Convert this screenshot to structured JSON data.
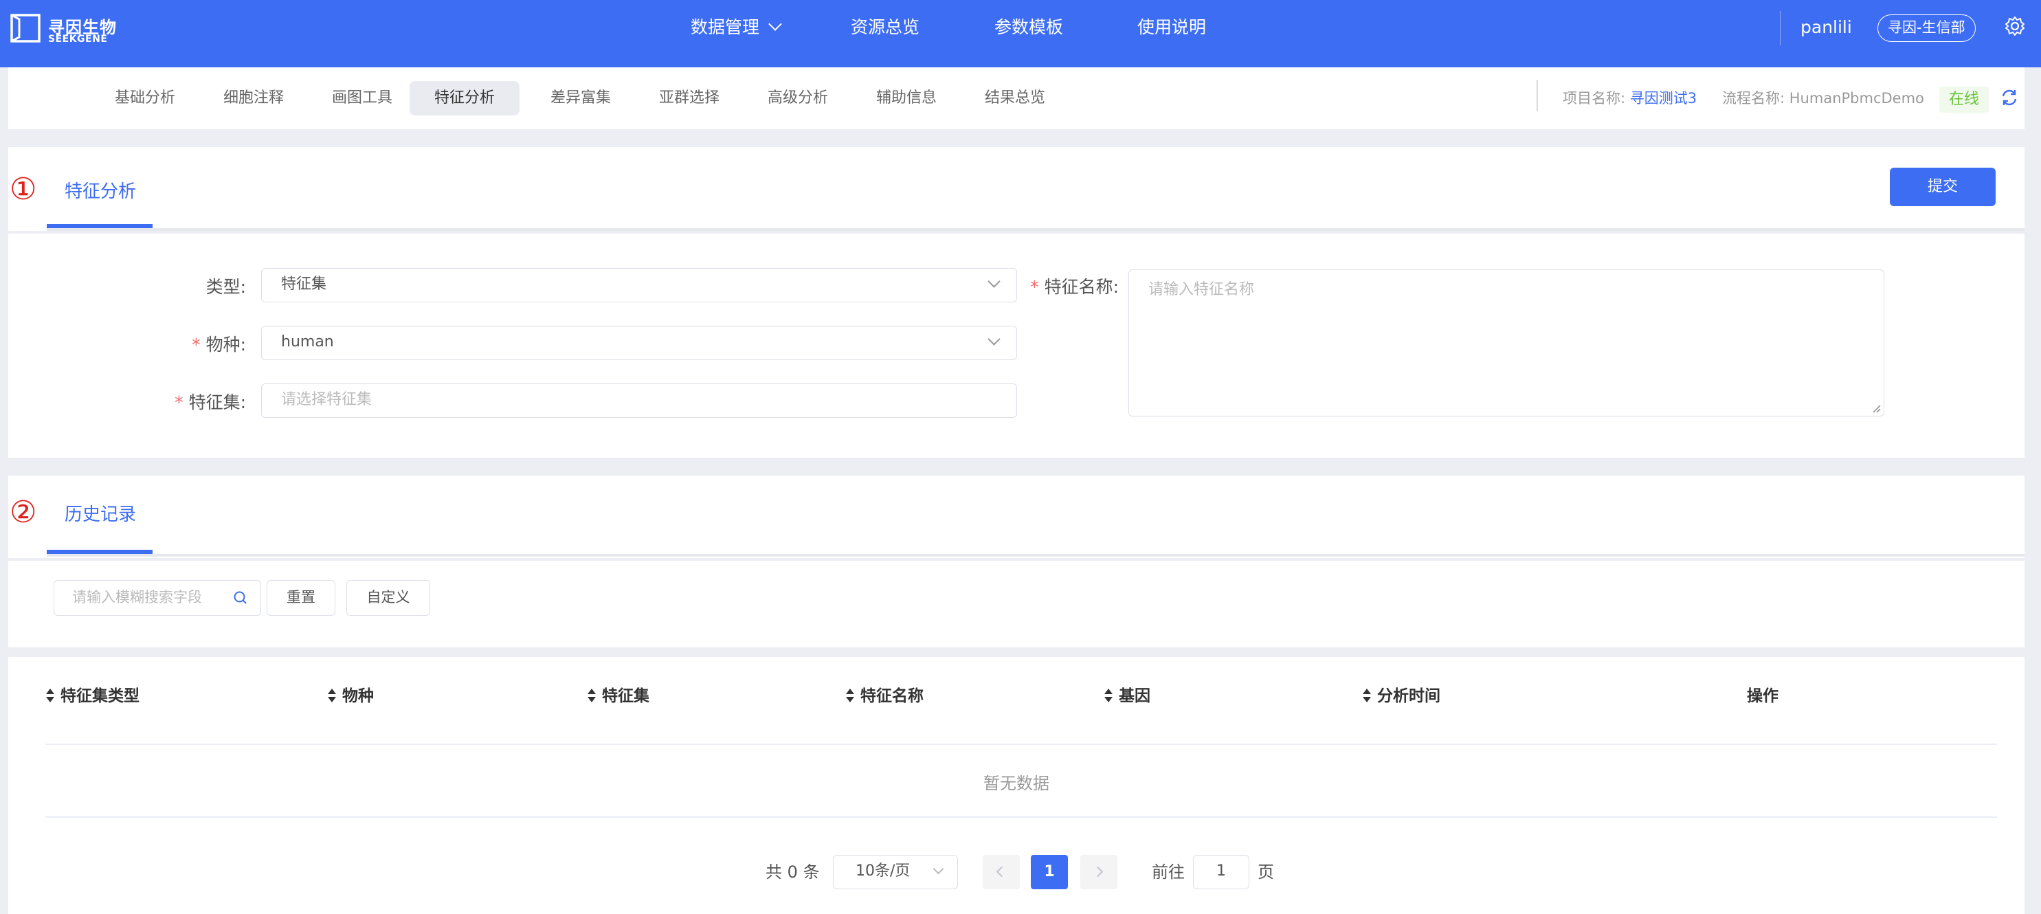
{
  "brand": {
    "name_cn": "寻因生物",
    "name_en": "SEEKGENE",
    "color": "#3d6df2"
  },
  "topnav": {
    "items": [
      "数据管理",
      "资源总览",
      "参数模板",
      "使用说明"
    ],
    "user": "panlili",
    "department": "寻因-生信部",
    "settings_icon": "gear-icon"
  },
  "tabs": {
    "items": [
      "基础分析",
      "细胞注释",
      "画图工具",
      "特征分析",
      "差异富集",
      "亚群选择",
      "高级分析",
      "辅助信息",
      "结果总览"
    ],
    "active": "特征分析"
  },
  "project": {
    "name_label": "项目名称:",
    "name_value": "寻因测试3",
    "flow_label": "流程名称:",
    "flow_value": "HumanPbmcDemo",
    "status": "在线",
    "status_color": "#67c23a"
  },
  "section1": {
    "num": "①",
    "title": "特征分析",
    "submit_label": "提交",
    "form": {
      "type_label": "类型:",
      "type_value": "特征集",
      "species_label": "物种:",
      "species_value": "human",
      "featureset_label": "特征集:",
      "featureset_placeholder": "请选择特征集",
      "featurename_label": "特征名称:",
      "featurename_placeholder": "请输入特征名称"
    }
  },
  "section2": {
    "num": "②",
    "title": "历史记录",
    "search_placeholder": "请输入模糊搜索字段",
    "reset_label": "重置",
    "custom_label": "自定义",
    "table": {
      "columns": [
        "特征集类型",
        "物种",
        "特征集",
        "特征名称",
        "基因",
        "分析时间"
      ],
      "action_column": "操作",
      "empty_text": "暂无数据"
    },
    "pagination": {
      "total_prefix": "共",
      "total": "0",
      "total_suffix": "条",
      "page_size": "10条/页",
      "current_page": "1",
      "goto_label": "前往",
      "goto_value": "1",
      "page_suffix": "页"
    }
  }
}
